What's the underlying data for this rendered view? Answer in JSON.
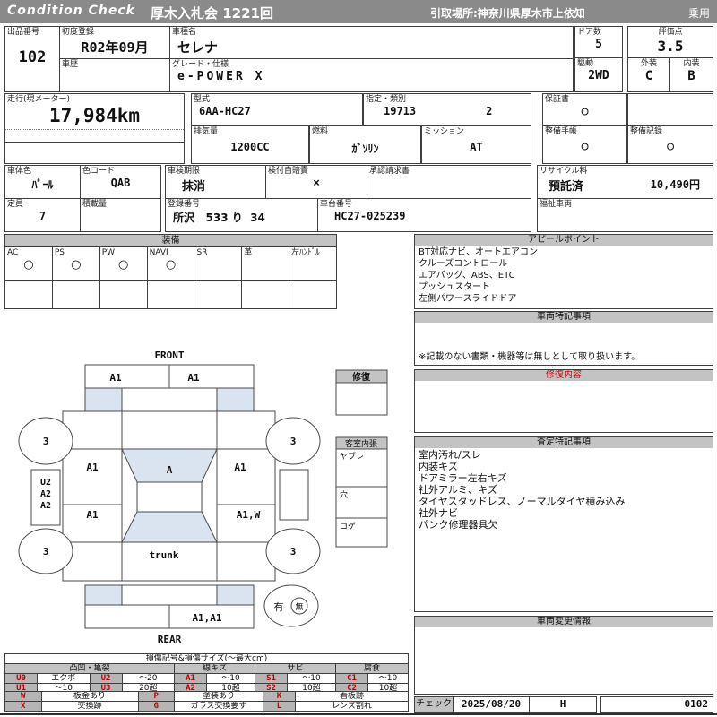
{
  "header": {
    "brand": "Condition Check",
    "title": "厚木入札会  1221回",
    "pickup": "引取場所:神奈川県厚木市上依知",
    "usage": "乗用"
  },
  "info": {
    "lot_label": "出品番号",
    "lot": "102",
    "first_reg_label": "初度登録",
    "first_reg": "R02年09月",
    "history_label": "車歴",
    "history": "",
    "model_name_label": "車種名",
    "model_name": "セレナ",
    "grade_label": "グレード・仕様",
    "grade": "e-POWER X",
    "doors_label": "ドア数",
    "doors": "5",
    "drive_label": "駆動",
    "drive": "2WD",
    "score_label": "評価点",
    "score": "3.5",
    "exterior_label": "外装",
    "exterior": "C",
    "interior_label": "内装",
    "interior": "B"
  },
  "spec": {
    "mileage_label": "走行(現メーター)",
    "mileage": "17,984km",
    "model_code_label": "型式",
    "model_code": "6AA-HC27",
    "type_label": "指定・類別",
    "type_no": "19713",
    "class_no": "2",
    "displacement_label": "排気量",
    "displacement": "1200CC",
    "fuel_label": "燃料",
    "fuel": "ｶﾞｿﾘﾝ",
    "mission_label": "ミッション",
    "mission": "AT",
    "warranty_label": "保証書",
    "warranty": "○",
    "maint_book_label": "整備手帳",
    "maint_book": "○",
    "maint_record_label": "整備記録",
    "maint_record": "○"
  },
  "registration": {
    "color_label": "車体色",
    "color": "ﾊﾟｰﾙ",
    "color_code_label": "色コード",
    "color_code": "QAB",
    "capacity_label": "定員",
    "capacity": "7",
    "load_label": "積載量",
    "load": "",
    "inspection_label": "車検期限",
    "inspection": "抹消",
    "insurance_label": "検付自賠責",
    "insurance": "×",
    "approval_label": "承認請求書",
    "approval": "",
    "reg_no_label": "登録番号",
    "reg_no": "所沢   533 り  34",
    "chassis_label": "車台番号",
    "chassis": "HC27-025239",
    "recycle_label": "リサイクル料",
    "recycle_status": "預託済",
    "recycle_fee": "10,490円",
    "welfare_label": "福祉車両",
    "welfare": ""
  },
  "equipment": {
    "title": "装備",
    "items": [
      {
        "label": "AC",
        "value": "○"
      },
      {
        "label": "PS",
        "value": "○"
      },
      {
        "label": "PW",
        "value": "○"
      },
      {
        "label": "NAVI",
        "value": "○"
      },
      {
        "label": "SR",
        "value": ""
      },
      {
        "label": "革",
        "value": ""
      },
      {
        "label": "左ﾊﾝﾄﾞﾙ",
        "value": ""
      }
    ]
  },
  "appeal": {
    "title": "アピールポイント",
    "lines": [
      "BT対応ナビ、オートエアコン",
      "クルーズコントロール",
      "エアバッグ、ABS、ETC",
      "プッシュスタート",
      "左側パワースライドドア"
    ]
  },
  "vehicle_notes": {
    "title": "車両特記事項",
    "note": "※記載のない書類・機器等は無しとして取り扱います。"
  },
  "repair": {
    "title": "修復内容",
    "content": ""
  },
  "assessment": {
    "title": "査定特記事項",
    "lines": [
      "室内汚れ/スレ",
      "内装キズ",
      "ドアミラー左右キズ",
      "社外アルミ、キズ",
      "タイヤスタッドレス、ノーマルタイヤ積み込み",
      "社外ナビ",
      "パンク修理器具欠"
    ]
  },
  "changes": {
    "title": "車両変更情報",
    "content": ""
  },
  "check": {
    "label": "チェック",
    "date": "2025/08/20",
    "inspector": "H",
    "number": "0102"
  },
  "diagram": {
    "front_label": "FRONT",
    "rear_label": "REAR",
    "trunk_label": "trunk",
    "hood_left": "A1",
    "hood_right": "A1",
    "front_left_door": "A1",
    "windshield": "A",
    "front_right_door": "A1",
    "rear_left_door": "A1",
    "rear_right_door": "A1,W",
    "left_sill": [
      "U2",
      "A2",
      "A2"
    ],
    "rear_bumper": "A1,A1",
    "wheels": [
      "3",
      "3",
      "3",
      "3"
    ],
    "spare_yes": "有",
    "spare_no": "無",
    "repair_title": "修復",
    "cabin_title": "客室内張",
    "cabin_rows": [
      "ヤブレ",
      "穴",
      "コゲ"
    ]
  },
  "legend": {
    "title": "損傷記号&損傷サイズ(〜最大cm)",
    "groups": [
      "凸凹・亀裂",
      "線キズ",
      "サビ",
      "腐食"
    ],
    "rows": [
      [
        {
          "code": "U0",
          "val": "エクボ"
        },
        {
          "code": "U2",
          "val": "〜20"
        },
        {
          "code": "A1",
          "val": "〜10"
        },
        {
          "code": "S1",
          "val": "〜10"
        },
        {
          "code": "C1",
          "val": "〜10"
        }
      ],
      [
        {
          "code": "U1",
          "val": "〜10"
        },
        {
          "code": "U3",
          "val": "20超"
        },
        {
          "code": "A2",
          "val": "10超"
        },
        {
          "code": "S2",
          "val": "10超"
        },
        {
          "code": "C2",
          "val": "10超"
        }
      ]
    ],
    "extra": [
      [
        {
          "code": "W",
          "val": "板金あり"
        },
        {
          "code": "P",
          "val": "塗装あり"
        },
        {
          "code": "K",
          "val": "看板跡"
        }
      ],
      [
        {
          "code": "X",
          "val": "交換跡"
        },
        {
          "code": "G",
          "val": "ガラス交換要す"
        },
        {
          "code": "L",
          "val": "レンズ割れ"
        }
      ]
    ]
  }
}
